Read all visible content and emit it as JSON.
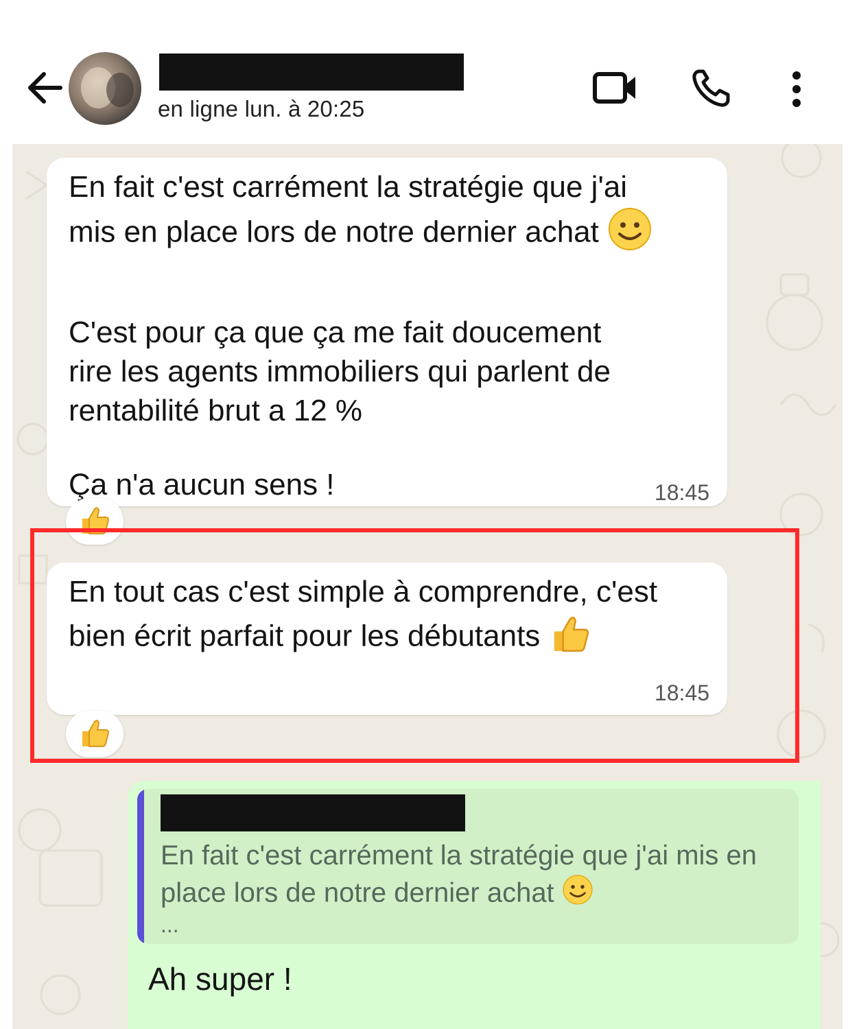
{
  "header": {
    "status": "en ligne lun. à 20:25"
  },
  "messages": [
    {
      "text": "En fait c'est carrément la stratégie que j'ai\nmis en place lors de notre dernier achat",
      "text2": "C'est pour ça que ça me fait doucement\nrire les agents immobiliers qui parlent de\nrentabilité brut a 12 %",
      "text3": "Ça n'a aucun sens !",
      "time": "18:45",
      "reaction": "thumbs-up"
    },
    {
      "text": "En tout cas c'est simple à comprendre, c'est\nbien écrit parfait pour les débutants",
      "time": "18:45",
      "reaction": "thumbs-up"
    }
  ],
  "reply": {
    "quoted_text": "En fait c'est carrément la stratégie que j'ai mis en\nplace lors de notre dernier achat",
    "quoted_more": "...",
    "text": "Ah super !"
  },
  "colors": {
    "chat_bg": "#efeae2",
    "outgoing_bubble": "#d9fdd3",
    "quote_bar": "#5a4fd6",
    "highlight": "#ff2a2a"
  }
}
